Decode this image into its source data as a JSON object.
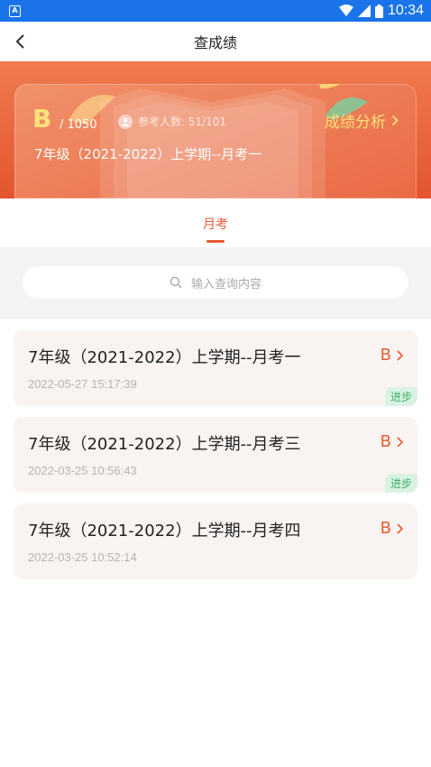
{
  "status_bar": {
    "time": "10:34"
  },
  "nav": {
    "title": "查成绩"
  },
  "summary": {
    "grade": "B",
    "total": "/ 1050",
    "participants": "参考人数: 51/101",
    "analysis_label": "成绩分析",
    "exam_name": "7年级（2021-2022）上学期--月考一"
  },
  "tabs": [
    {
      "label": "月考",
      "active": true
    }
  ],
  "search": {
    "placeholder": "输入查询内容"
  },
  "records": [
    {
      "title": "7年级（2021-2022）上学期--月考一",
      "time": "2022-05-27 15:17:39",
      "grade": "B",
      "badge": "进步"
    },
    {
      "title": "7年级（2021-2022）上学期--月考三",
      "time": "2022-03-25 10:56:43",
      "grade": "B",
      "badge": "进步"
    },
    {
      "title": "7年级（2021-2022）上学期--月考四",
      "time": "2022-03-25 10:52:14",
      "grade": "B",
      "badge": ""
    }
  ],
  "colors": {
    "accent": "#e75a31",
    "gold": "#ffe27a",
    "progress_green": "#3bb06a",
    "status_bar": "#1a73e8"
  }
}
